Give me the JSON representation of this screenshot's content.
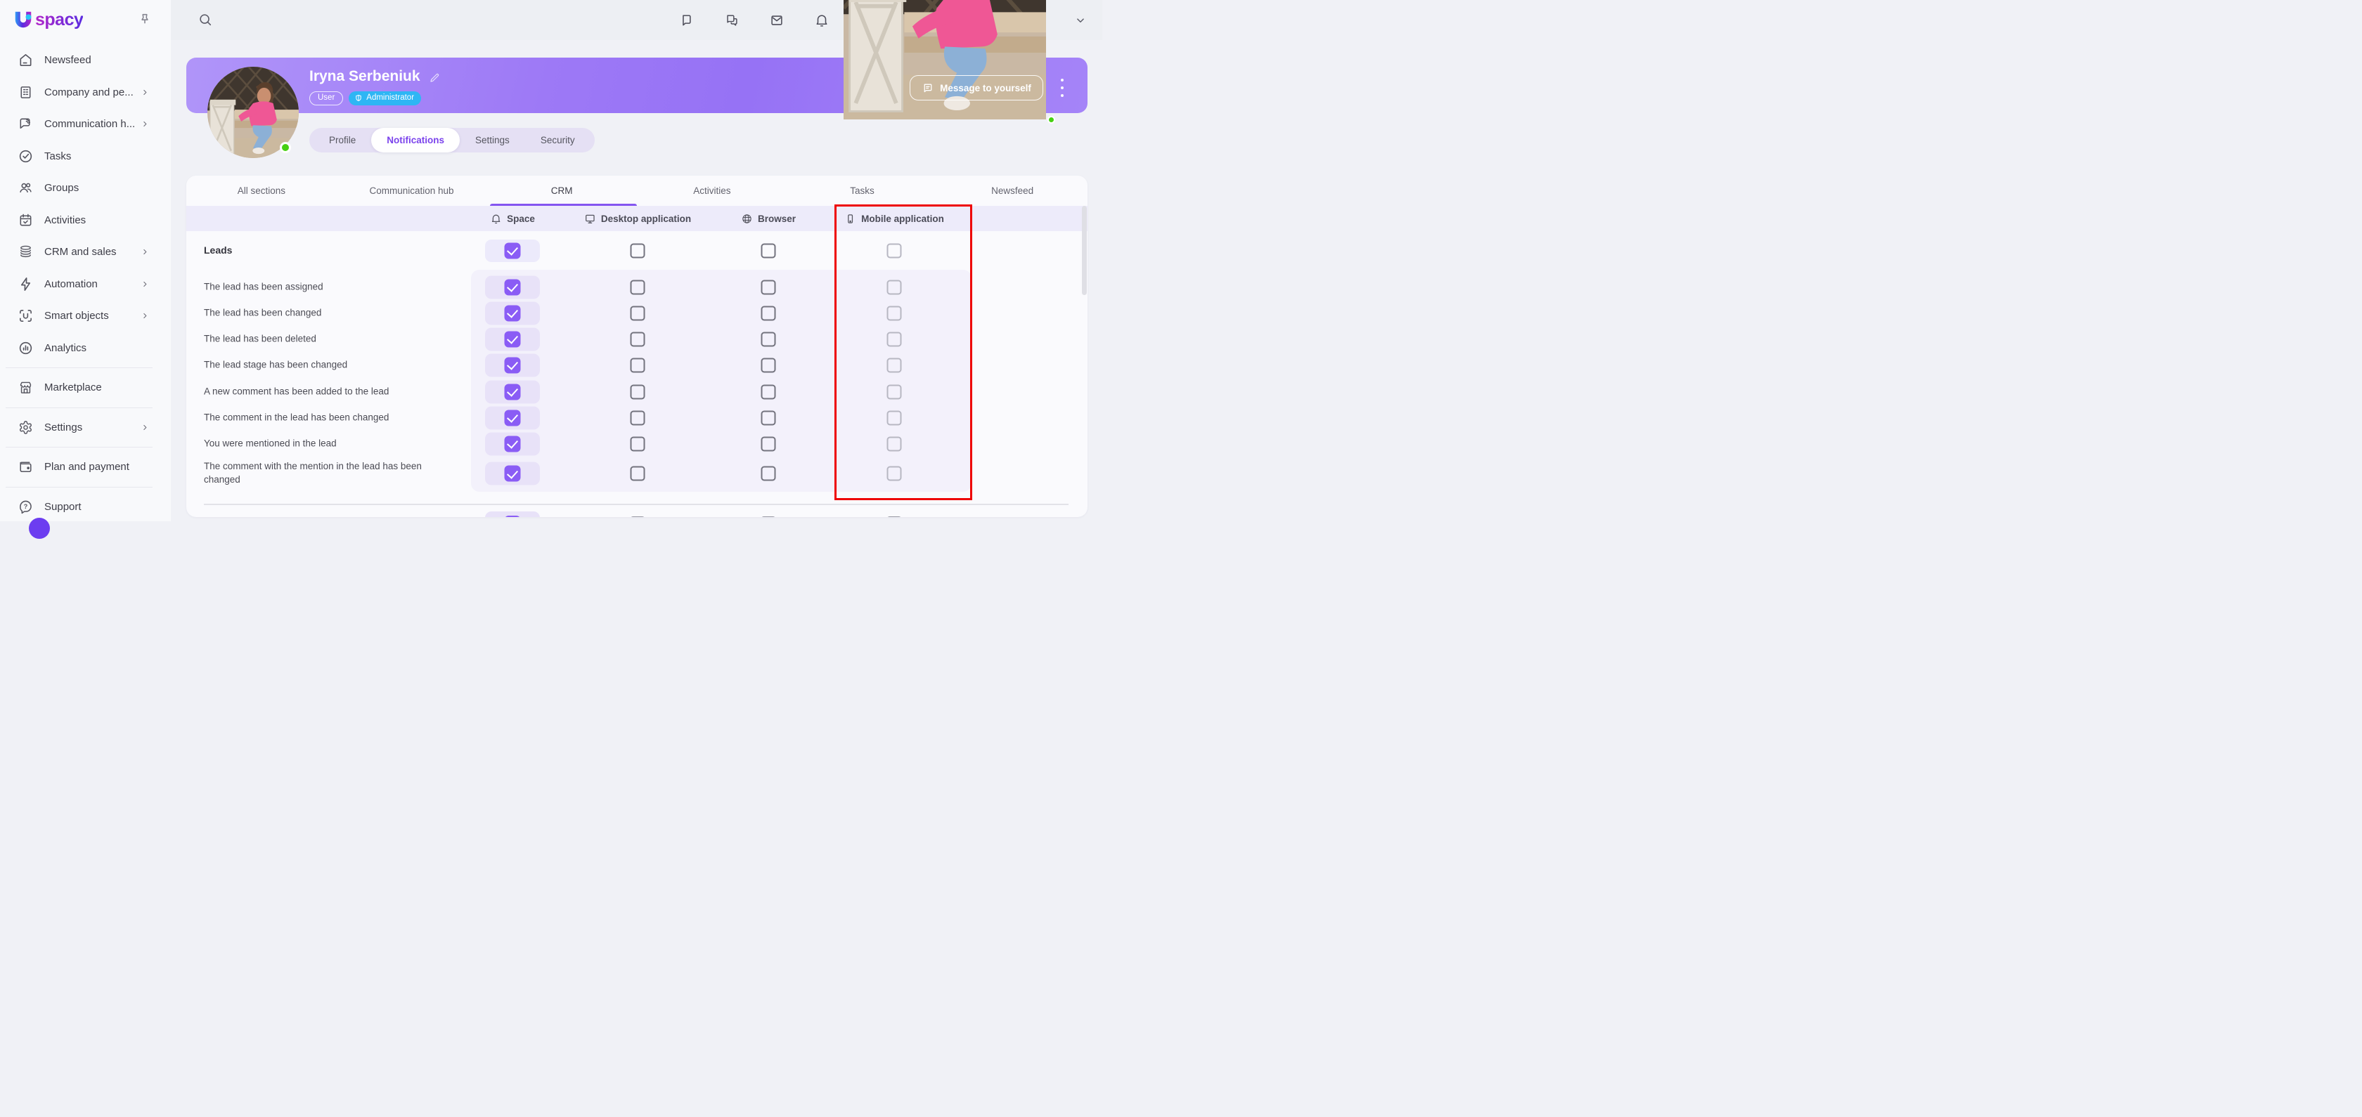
{
  "brand": {
    "name": "Uspacy",
    "logo_text": "spacy"
  },
  "sidebar": {
    "pin_icon": "pin-icon",
    "items": [
      {
        "label": "Newsfeed",
        "icon": "home",
        "chevron": false,
        "divider_after": false
      },
      {
        "label": "Company and pe...",
        "icon": "company",
        "chevron": true,
        "divider_after": false
      },
      {
        "label": "Communication h...",
        "icon": "comm-hub",
        "chevron": true,
        "divider_after": false
      },
      {
        "label": "Tasks",
        "icon": "tasks",
        "chevron": false,
        "divider_after": false
      },
      {
        "label": "Groups",
        "icon": "groups",
        "chevron": false,
        "divider_after": false
      },
      {
        "label": "Activities",
        "icon": "activities",
        "chevron": false,
        "divider_after": false
      },
      {
        "label": "CRM and sales",
        "icon": "crm",
        "chevron": true,
        "divider_after": false
      },
      {
        "label": "Automation",
        "icon": "automation",
        "chevron": true,
        "divider_after": false
      },
      {
        "label": "Smart objects",
        "icon": "smart-objects",
        "chevron": true,
        "divider_after": false
      },
      {
        "label": "Analytics",
        "icon": "analytics",
        "chevron": false,
        "divider_after": true
      },
      {
        "label": "Marketplace",
        "icon": "marketplace",
        "chevron": false,
        "divider_after": true
      },
      {
        "label": "Settings",
        "icon": "settings",
        "chevron": true,
        "divider_after": true
      },
      {
        "label": "Plan and payment",
        "icon": "plan",
        "chevron": false,
        "divider_after": true
      },
      {
        "label": "Support",
        "icon": "support",
        "chevron": false,
        "divider_after": false
      }
    ]
  },
  "topbar": {
    "icons": [
      "chat",
      "chats",
      "mail",
      "bell-top"
    ],
    "user_status": "online"
  },
  "profile": {
    "name": "Iryna Serbeniuk",
    "role_badge": "User",
    "admin_badge": "Administrator",
    "message_button": "Message to yourself",
    "status_color": "#47d012"
  },
  "profile_tabs": [
    {
      "label": "Profile",
      "active": false
    },
    {
      "label": "Notifications",
      "active": true
    },
    {
      "label": "Settings",
      "active": false
    },
    {
      "label": "Security",
      "active": false
    }
  ],
  "section_tabs": [
    {
      "label": "All sections",
      "active": false
    },
    {
      "label": "Communication hub",
      "active": false
    },
    {
      "label": "CRM",
      "active": true
    },
    {
      "label": "Activities",
      "active": false
    },
    {
      "label": "Tasks",
      "active": false
    },
    {
      "label": "Newsfeed",
      "active": false
    }
  ],
  "notifications_table": {
    "columns": [
      {
        "label": "Space",
        "icon": "bell",
        "highlighted": false
      },
      {
        "label": "Desktop application",
        "icon": "monitor",
        "highlighted": false
      },
      {
        "label": "Browser",
        "icon": "globe",
        "highlighted": false
      },
      {
        "label": "Mobile application",
        "icon": "smartphone",
        "highlighted": true
      }
    ],
    "group_row": {
      "label": "Leads",
      "space": true,
      "desktop": false,
      "browser": false,
      "mobile": false
    },
    "rows": [
      {
        "label": "The lead has been assigned",
        "space": true,
        "desktop": false,
        "browser": false,
        "mobile": false
      },
      {
        "label": "The lead has been changed",
        "space": true,
        "desktop": false,
        "browser": false,
        "mobile": false
      },
      {
        "label": "The lead has been deleted",
        "space": true,
        "desktop": false,
        "browser": false,
        "mobile": false
      },
      {
        "label": "The lead stage has been changed",
        "space": true,
        "desktop": false,
        "browser": false,
        "mobile": false
      },
      {
        "label": "A new comment has been added to the lead",
        "space": true,
        "desktop": false,
        "browser": false,
        "mobile": false
      },
      {
        "label": "The comment in the lead has been changed",
        "space": true,
        "desktop": false,
        "browser": false,
        "mobile": false
      },
      {
        "label": "You were mentioned in the lead",
        "space": true,
        "desktop": false,
        "browser": false,
        "mobile": false
      },
      {
        "label": "The comment with the mention in the lead has been changed",
        "space": true,
        "desktop": false,
        "browser": false,
        "mobile": false
      }
    ],
    "partial_next_row": {
      "space": true,
      "desktop": false,
      "browser": false,
      "mobile": false
    }
  },
  "annotation": {
    "highlight_color": "#ee0202",
    "shape": "rectangle"
  },
  "colors": {
    "accent_purple": "#8a5cf5",
    "banner_purple": "#9d79f6",
    "admin_blue": "#2eb6f4",
    "active_tab_text": "#7b43ec",
    "online_green": "#47d012"
  }
}
